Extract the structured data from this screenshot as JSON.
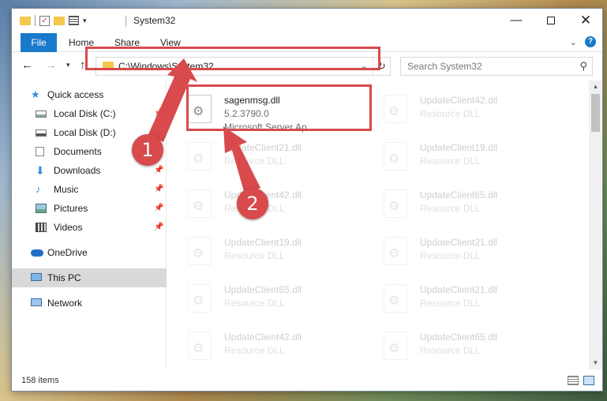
{
  "window": {
    "title": "System32",
    "controls": {
      "minimize": "—",
      "maximize": "",
      "close": "✕"
    }
  },
  "ribbon": {
    "tabs": [
      {
        "label": "File"
      },
      {
        "label": "Home"
      },
      {
        "label": "Share"
      },
      {
        "label": "View"
      }
    ]
  },
  "nav": {
    "back_icon": "←",
    "forward_icon": "→",
    "recent_icon": "▾",
    "up_icon": "↑"
  },
  "address": {
    "path": "C:\\Windows\\System32",
    "dropdown_icon": "⌄",
    "refresh_icon": "↻"
  },
  "search": {
    "placeholder": "Search System32",
    "icon": "⚲"
  },
  "sidebar": {
    "items": [
      {
        "label": "Quick access",
        "icon": "star-icon",
        "pinned": false
      },
      {
        "label": "Local Disk (C:)",
        "icon": "drive-icon",
        "pinned": true
      },
      {
        "label": "Local Disk (D:)",
        "icon": "drive-icon",
        "pinned": false
      },
      {
        "label": "Documents",
        "icon": "documents-icon",
        "pinned": false
      },
      {
        "label": "Downloads",
        "icon": "download-icon",
        "pinned": true
      },
      {
        "label": "Music",
        "icon": "music-icon",
        "pinned": true
      },
      {
        "label": "Pictures",
        "icon": "pictures-icon",
        "pinned": true
      },
      {
        "label": "Videos",
        "icon": "videos-icon",
        "pinned": true
      },
      {
        "label": "OneDrive",
        "icon": "cloud-icon",
        "pinned": false
      },
      {
        "label": "This PC",
        "icon": "computer-icon",
        "pinned": false,
        "selected": true
      },
      {
        "label": "Network",
        "icon": "network-icon",
        "pinned": false
      }
    ],
    "pin_glyph": "📌"
  },
  "files": [
    {
      "name": "sagenmsg.dll",
      "version": "5.2.3790.0",
      "description": "Microsoft Server Ap..."
    },
    {
      "name": "UpdateClient42.dll",
      "type": "Resource DLL"
    },
    {
      "name": "UpdateClient21.dll",
      "type": "Resource DLL"
    },
    {
      "name": "UpdateClient19.dll",
      "type": "Resource DLL"
    },
    {
      "name": "UpdateClient42.dll",
      "type": "Resource DLL"
    },
    {
      "name": "UpdateClient65.dll",
      "type": "Resource DLL"
    },
    {
      "name": "UpdateClient19.dll",
      "type": "Resource DLL"
    },
    {
      "name": "UpdateClient21.dll",
      "type": "Resource DLL"
    },
    {
      "name": "UpdateClient65.dll",
      "type": "Resource DLL"
    },
    {
      "name": "UpdateClient21.dll",
      "type": "Resource DLL"
    },
    {
      "name": "UpdateClient42.dll",
      "type": "Resource DLL"
    },
    {
      "name": "UpdateClient65.dll",
      "type": "Resource DLL"
    }
  ],
  "status": {
    "item_count": "158 items"
  },
  "callouts": [
    {
      "label": "1"
    },
    {
      "label": "2"
    }
  ],
  "colors": {
    "accent": "#1979ca",
    "highlight": "#d84a4c"
  }
}
